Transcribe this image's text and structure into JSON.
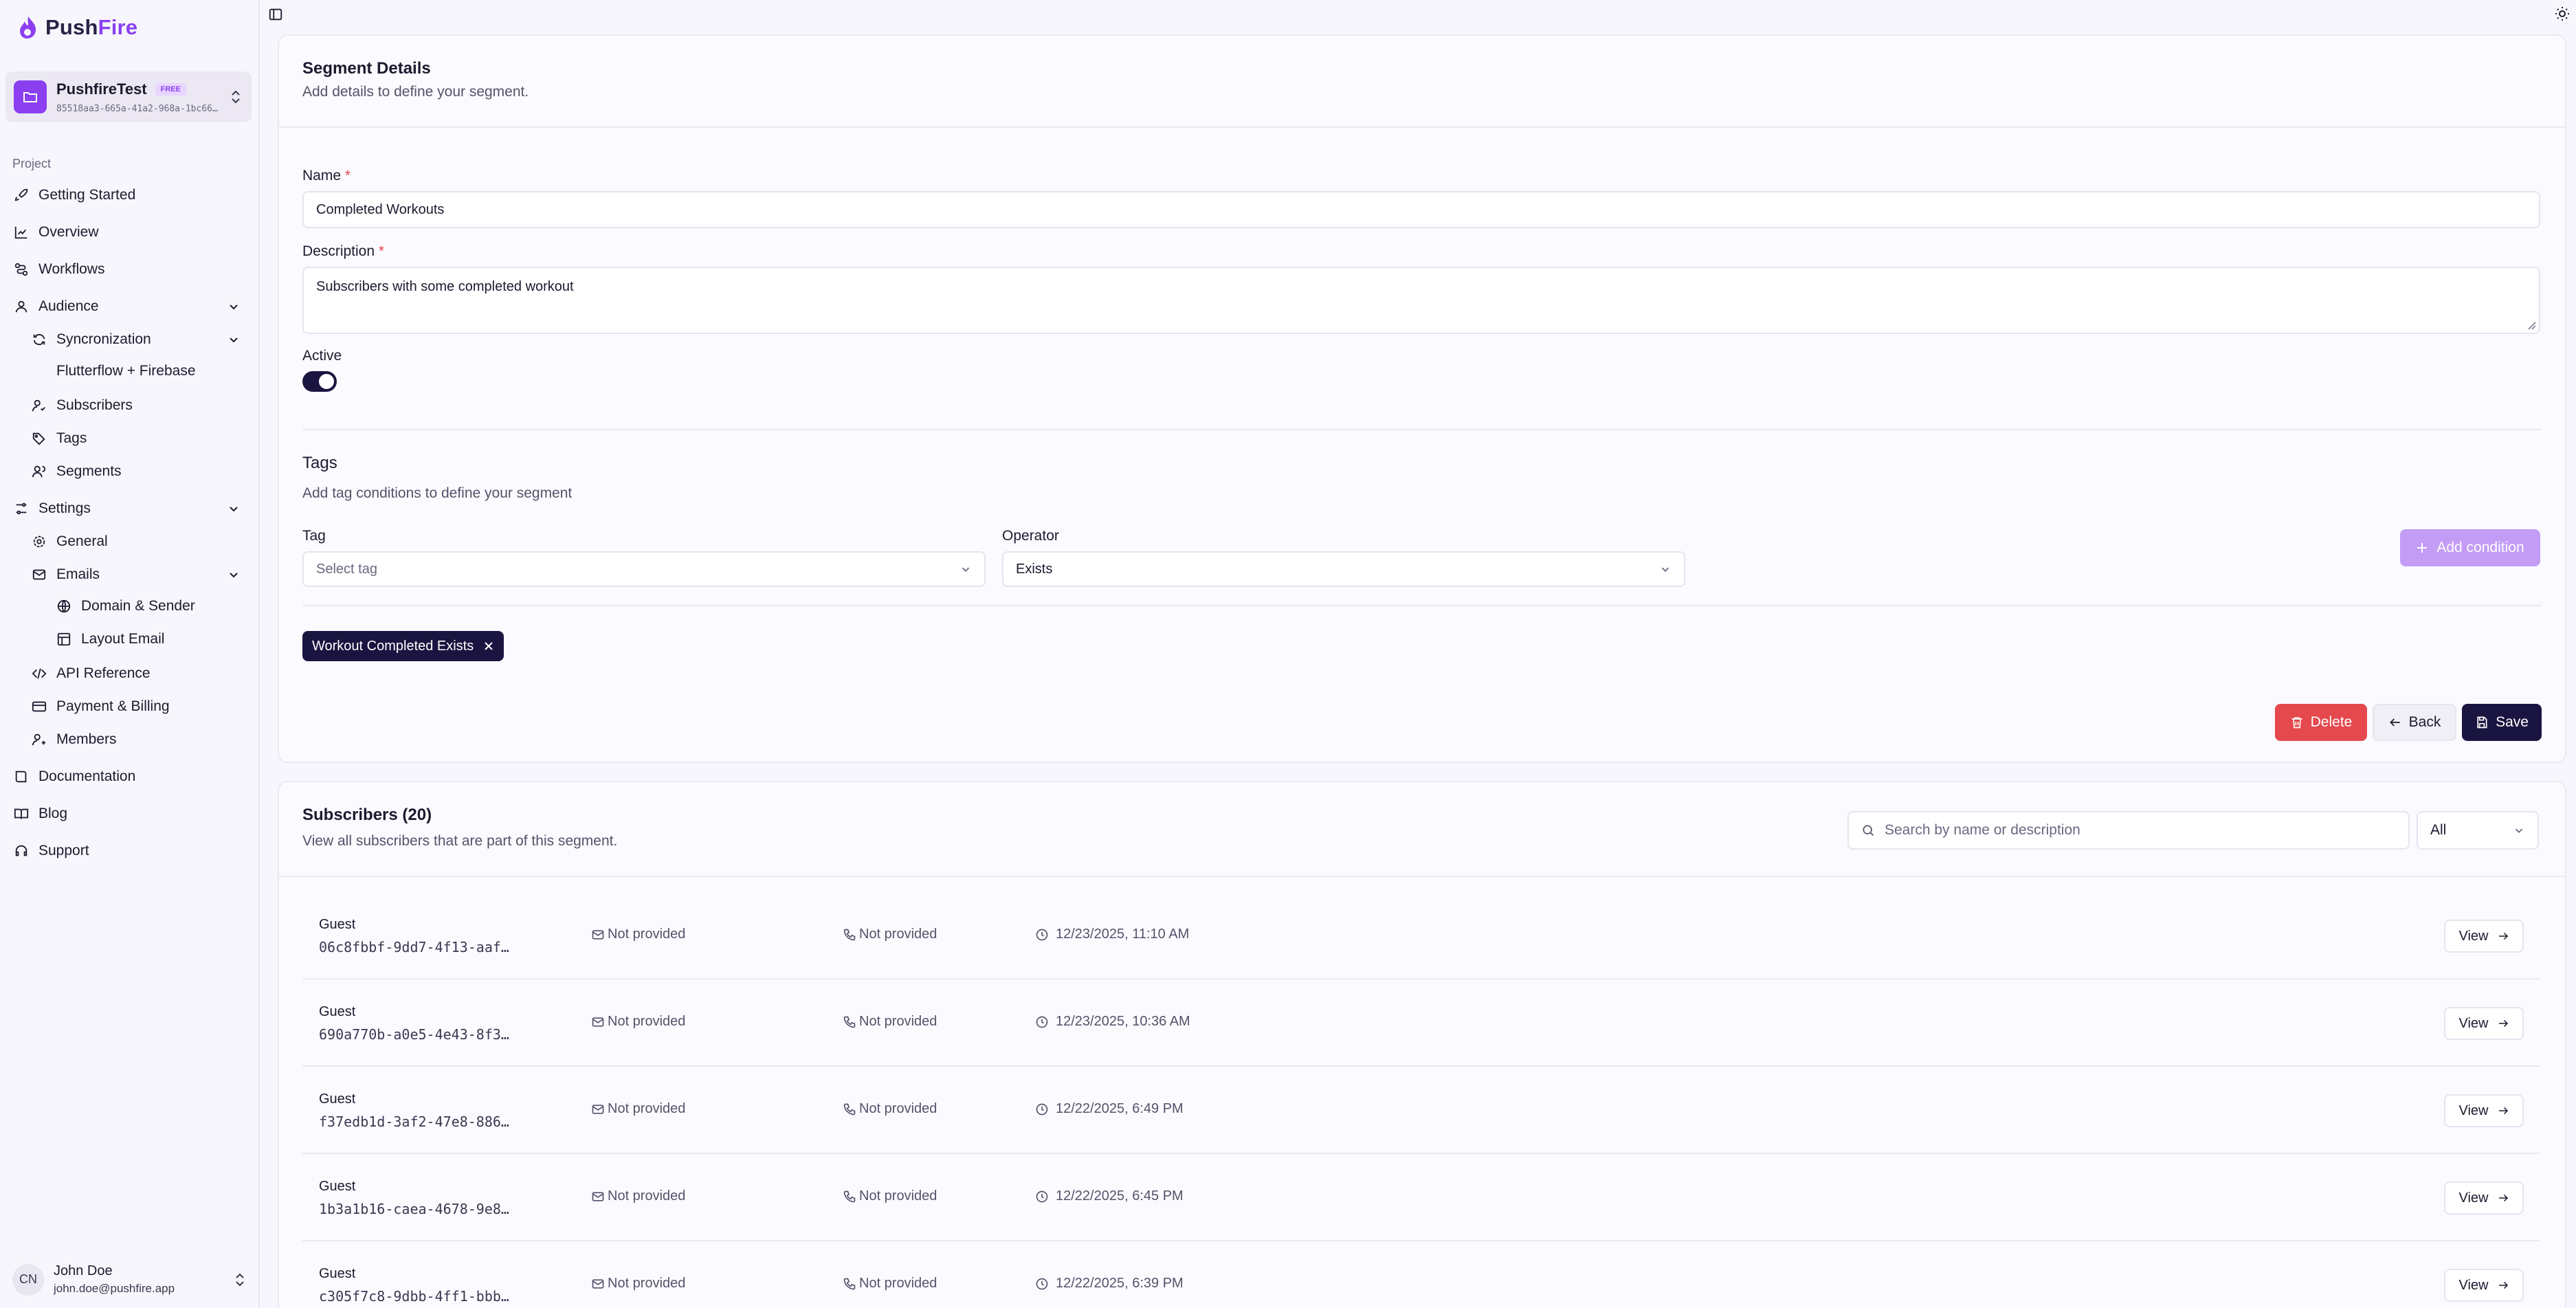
{
  "app": {
    "brand_part1": "Push",
    "brand_part2": "Fire"
  },
  "org": {
    "name": "PushfireTest",
    "plan": "FREE",
    "id": "85518aa3-665a-41a2-968a-1bc66…"
  },
  "sidebar": {
    "section": "Project",
    "items": {
      "getting_started": "Getting Started",
      "overview": "Overview",
      "workflows": "Workflows",
      "audience": "Audience",
      "syncronization": "Syncronization",
      "flutterflow": "Flutterflow + Firebase",
      "subscribers": "Subscribers",
      "tags": "Tags",
      "segments": "Segments",
      "settings": "Settings",
      "general": "General",
      "emails": "Emails",
      "domain_sender": "Domain & Sender",
      "layout_email": "Layout Email",
      "api_reference": "API Reference",
      "payment_billing": "Payment & Billing",
      "members": "Members",
      "documentation": "Documentation",
      "blog": "Blog",
      "support": "Support"
    }
  },
  "user": {
    "initials": "CN",
    "name": "John Doe",
    "email": "john.doe@pushfire.app"
  },
  "segment": {
    "title": "Segment Details",
    "subtitle": "Add details to define your segment.",
    "name_label": "Name",
    "name_value": "Completed Workouts",
    "description_label": "Description",
    "description_value": "Subscribers with some completed workout",
    "active_label": "Active",
    "active": true,
    "required_mark": "*"
  },
  "tags": {
    "title": "Tags",
    "subtitle": "Add tag conditions to define your segment",
    "tag_label": "Tag",
    "tag_placeholder": "Select tag",
    "operator_label": "Operator",
    "operator_value": "Exists",
    "add_condition": "Add condition",
    "conditions": [
      "Workout Completed Exists"
    ]
  },
  "actions": {
    "delete": "Delete",
    "back": "Back",
    "save": "Save"
  },
  "subscribers": {
    "title": "Subscribers (20)",
    "subtitle": "View all subscribers that are part of this segment.",
    "search_placeholder": "Search by name or description",
    "filter_value": "All",
    "view_label": "View",
    "rows": [
      {
        "name": "Guest",
        "id": "06c8fbbf-9dd7-4f13-aaf…",
        "email": "Not provided",
        "phone": "Not provided",
        "date": "12/23/2025, 11:10 AM"
      },
      {
        "name": "Guest",
        "id": "690a770b-a0e5-4e43-8f3…",
        "email": "Not provided",
        "phone": "Not provided",
        "date": "12/23/2025, 10:36 AM"
      },
      {
        "name": "Guest",
        "id": "f37edb1d-3af2-47e8-886…",
        "email": "Not provided",
        "phone": "Not provided",
        "date": "12/22/2025, 6:49 PM"
      },
      {
        "name": "Guest",
        "id": "1b3a1b16-caea-4678-9e8…",
        "email": "Not provided",
        "phone": "Not provided",
        "date": "12/22/2025, 6:45 PM"
      },
      {
        "name": "Guest",
        "id": "c305f7c8-9dbb-4ff1-bbb…",
        "email": "Not provided",
        "phone": "Not provided",
        "date": "12/22/2025, 6:39 PM"
      }
    ]
  },
  "colors": {
    "accent": "#8b3ff0",
    "primary_dark": "#1a1540",
    "danger": "#e5484d"
  }
}
